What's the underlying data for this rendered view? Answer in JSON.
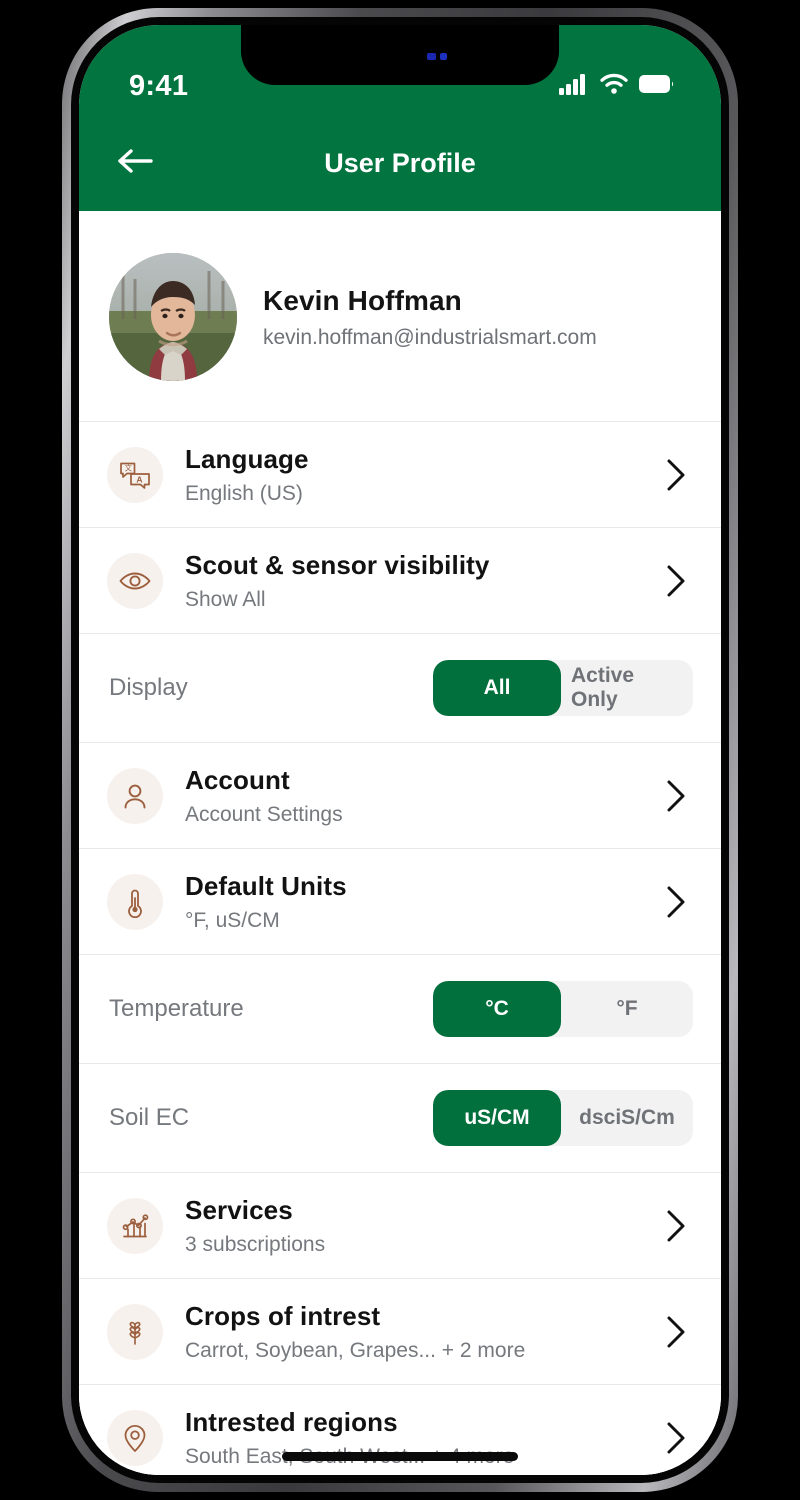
{
  "statusbar": {
    "time": "9:41",
    "signal_icon": "cellular-signal-icon",
    "wifi_icon": "wifi-icon",
    "battery_icon": "battery-icon"
  },
  "header": {
    "title": "User Profile",
    "back_icon": "back-arrow-icon",
    "background_color": "#027440"
  },
  "profile": {
    "name": "Kevin Hoffman",
    "email": "kevin.hoffman@industrialsmart.com",
    "avatar_icon": "user-avatar-photo"
  },
  "settings_rows": [
    {
      "icon": "translate-icon",
      "title": "Language",
      "subtitle": "English (US)",
      "chevron": "chevron-right-icon"
    },
    {
      "icon": "eye-icon",
      "title": "Scout & sensor visibility",
      "subtitle": "Show All",
      "chevron": "chevron-right-icon"
    },
    {
      "icon": "person-icon",
      "title": "Account",
      "subtitle": "Account Settings",
      "chevron": "chevron-right-icon"
    },
    {
      "icon": "thermometer-icon",
      "title": "Default Units",
      "subtitle": "°F, uS/CM",
      "chevron": "chevron-right-icon"
    },
    {
      "icon": "chart-icon",
      "title": "Services",
      "subtitle": "3 subscriptions",
      "chevron": "chevron-right-icon"
    },
    {
      "icon": "wheat-icon",
      "title": "Crops of intrest",
      "subtitle": "Carrot, Soybean, Grapes... + 2 more",
      "chevron": "chevron-right-icon"
    },
    {
      "icon": "map-pin-icon",
      "title": "Intrested regions",
      "subtitle": "South East, South West... + 4 more",
      "chevron": "chevron-right-icon"
    }
  ],
  "toggles": {
    "display": {
      "label": "Display",
      "options": [
        "All",
        "Active Only"
      ],
      "selected": "All"
    },
    "temperature": {
      "label": "Temperature",
      "options": [
        "°C",
        "°F"
      ],
      "selected": "°C"
    },
    "soil_ec": {
      "label": "Soil EC",
      "options": [
        "uS/CM",
        "dsciS/Cm"
      ],
      "selected": "uS/CM"
    }
  },
  "theme": {
    "brand_green": "#027440",
    "icon_brown": "#9c5f3d",
    "icon_bg": "#f7f1ee",
    "muted_text": "#75787d"
  }
}
